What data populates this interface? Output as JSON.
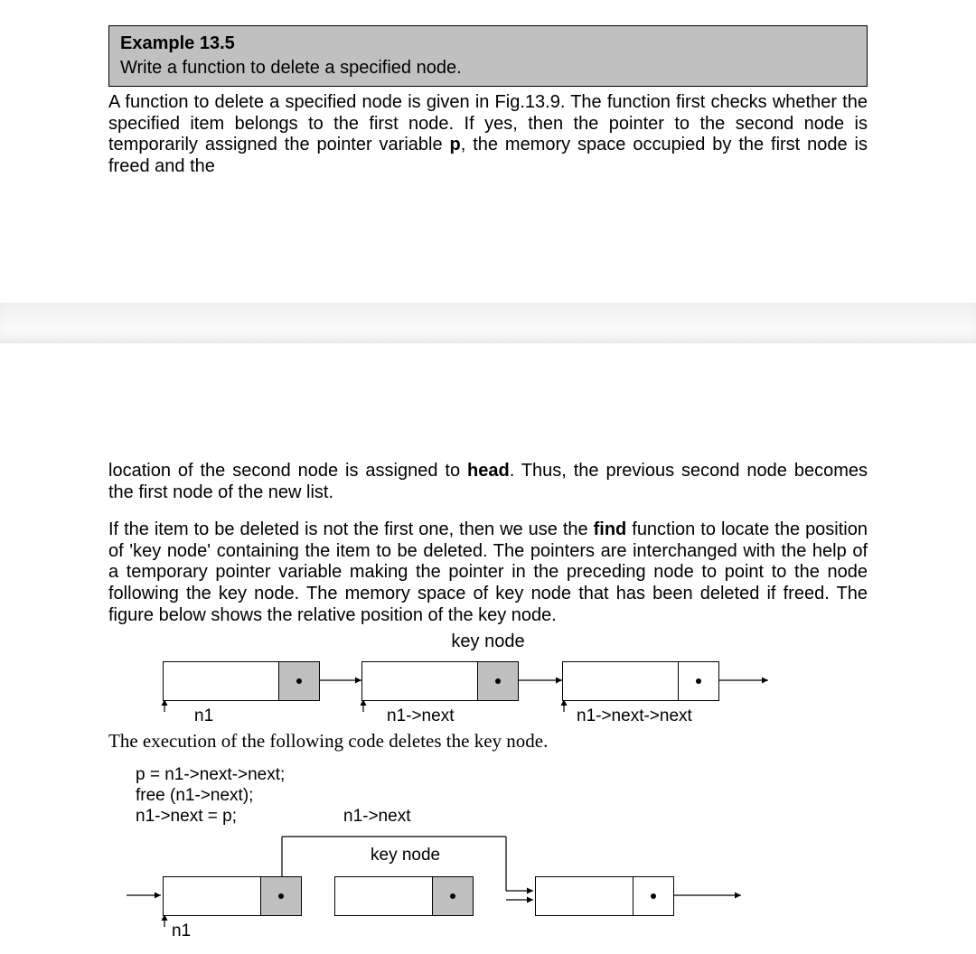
{
  "example": {
    "title": "Example 13.5",
    "desc": "Write a function to delete a specified node."
  },
  "para1_a": "A function to delete a specified node is given in Fig.13.9.  The function first checks whether the specified item belongs to the first node.  If yes, then the pointer to the second node is temporarily assigned the pointer variable ",
  "para1_bold": "p",
  "para1_b": ", the memory space occupied by the first node is freed and the",
  "para2_a": "location of the second node is assigned to ",
  "para2_bold": "head",
  "para2_b": ".  Thus, the previous second node becomes the first node of the new list.",
  "para3_a": "If the item to be deleted is not the first one, then we use the ",
  "para3_bold": "find",
  "para3_b": " function to locate the position of 'key node' containing the item to be deleted. The pointers are interchanged with the help of a temporary pointer variable making the pointer in the preceding node to point to the node following the key node.  The memory space of key node that has been deleted if freed.  The figure below shows the relative position of the key node.",
  "fig1": {
    "caption": "key node",
    "labels": {
      "a": "n1",
      "b": "n1->next",
      "c": "n1->next->next"
    }
  },
  "sentence": "The execution of the following code deletes the key node.",
  "code": {
    "l1": "p = n1->next->next;",
    "l2": "free (n1->next);",
    "l3": "n1->next = p;"
  },
  "fig2": {
    "top_label": "n1->next",
    "caption": "key node",
    "bottom_label": "n1"
  }
}
